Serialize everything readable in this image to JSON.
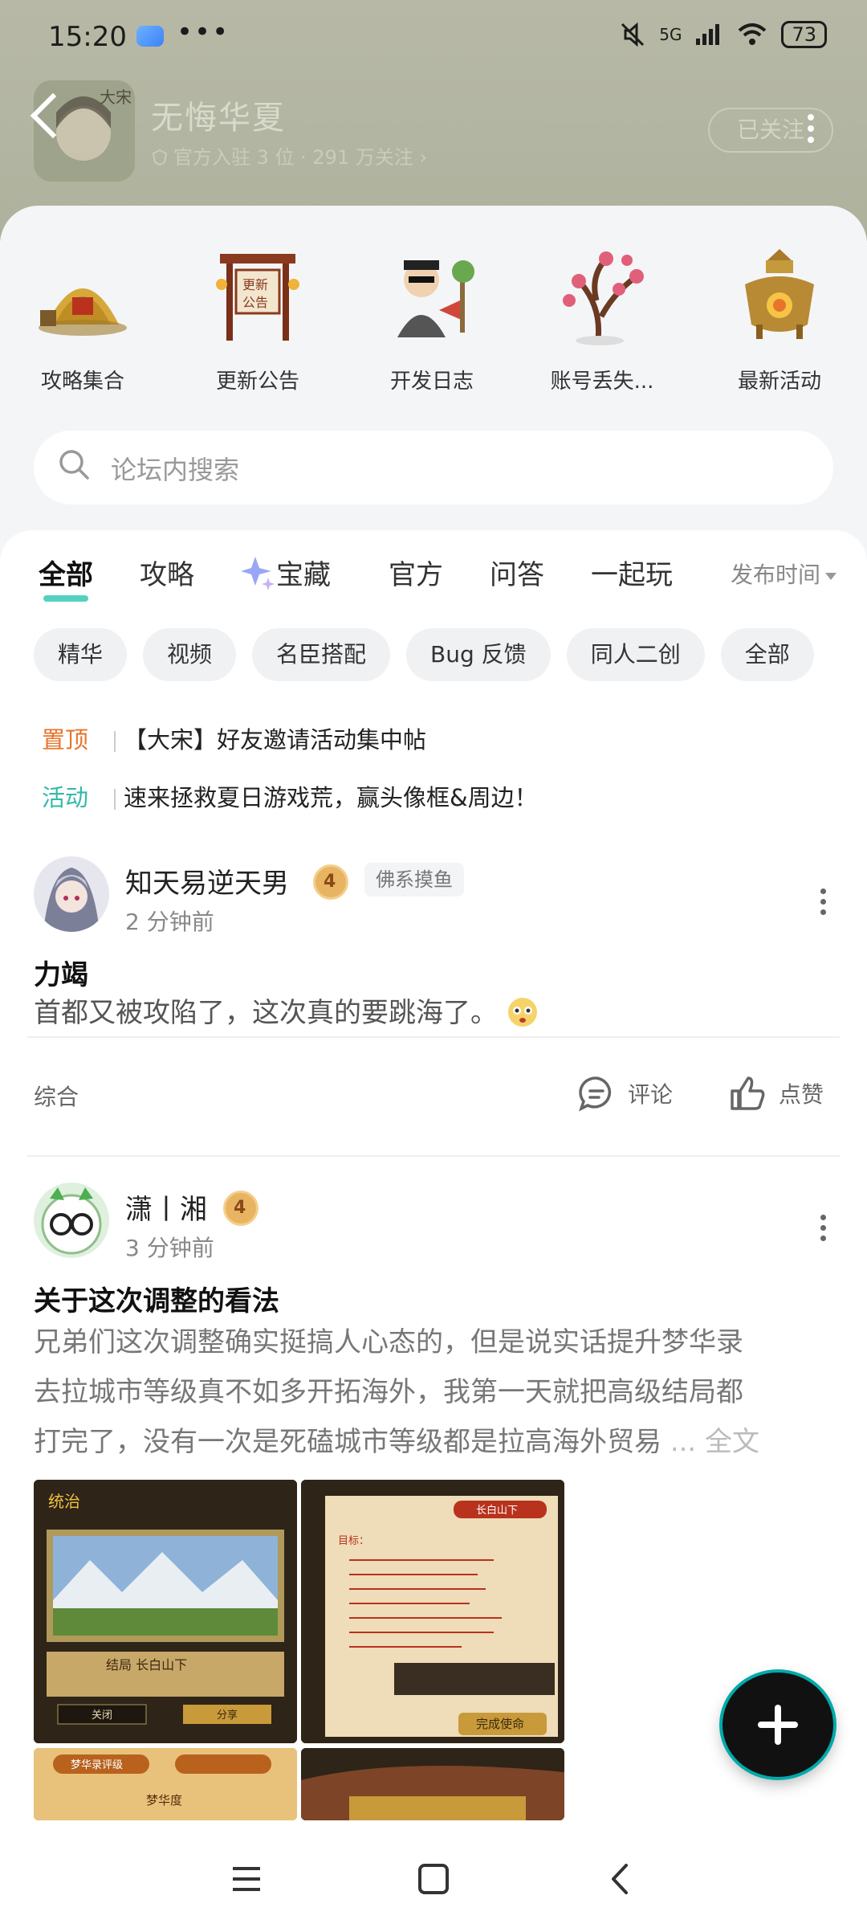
{
  "status_bar": {
    "time": "15:20",
    "dots": "•••",
    "network": "5G",
    "battery": "73"
  },
  "header": {
    "forum_name": "无悔华夏",
    "forum_sub": "官方入驻 3 位 · 291 万关注 ›",
    "follow_label": "已关注",
    "avatar_text": "大宋"
  },
  "categories": [
    {
      "label": "攻略集合",
      "icon": "haystack-icon"
    },
    {
      "label": "更新公告",
      "icon": "notice-board-icon"
    },
    {
      "label": "开发日志",
      "icon": "developer-icon"
    },
    {
      "label": "账号丢失...",
      "icon": "plum-blossom-icon"
    },
    {
      "label": "最新活动",
      "icon": "bronze-cauldron-icon"
    }
  ],
  "search": {
    "placeholder": "论坛内搜索"
  },
  "tabs": [
    "全部",
    "攻略",
    "宝藏",
    "官方",
    "问答",
    "一起玩"
  ],
  "sort_label": "发布时间",
  "chips": [
    "精华",
    "视频",
    "名臣搭配",
    "Bug 反馈",
    "同人二创",
    "全部"
  ],
  "notices": [
    {
      "tag": "置顶",
      "tag_color": "#e8742c",
      "text": "【大宋】好友邀请活动集中帖"
    },
    {
      "tag": "活动",
      "tag_color": "#34b8a8",
      "text": "速来拯救夏日游戏荒，赢头像框&周边！"
    }
  ],
  "posts": [
    {
      "author": "知天易逆天男",
      "level": "4",
      "badge": "佛系摸鱼",
      "time": "2 分钟前",
      "title": "力竭",
      "body": "首都又被攻陷了，这次真的要跳海了。",
      "category": "综合",
      "comment_label": "评论",
      "like_label": "点赞"
    },
    {
      "author": "潇丨湘",
      "level": "4",
      "time": "3 分钟前",
      "title": "关于这次调整的看法",
      "body_lines": [
        "兄弟们这次调整确实挺搞人心态的，但是说实话提升梦华录",
        "去拉城市等级真不如多开拓海外，我第一天就把高级结局都",
        "打完了，没有一次是死磕城市等级都是拉高海外贸易"
      ],
      "more_label": "... 全文",
      "images": [
        {
          "heading": "统治",
          "sub": "结局  长白山下",
          "btn_a": "关闭",
          "btn_b": "分享"
        },
        {
          "heading": "长白山下",
          "sub": "目标：",
          "btn": "完成使命"
        },
        {
          "heading": "梦华录评级",
          "sub": "梦华度"
        },
        {
          "heading": "",
          "sub": ""
        }
      ]
    }
  ],
  "colors": {
    "accent": "#3cc2b4",
    "pinned": "#e8742c",
    "activity": "#34b8a8"
  }
}
